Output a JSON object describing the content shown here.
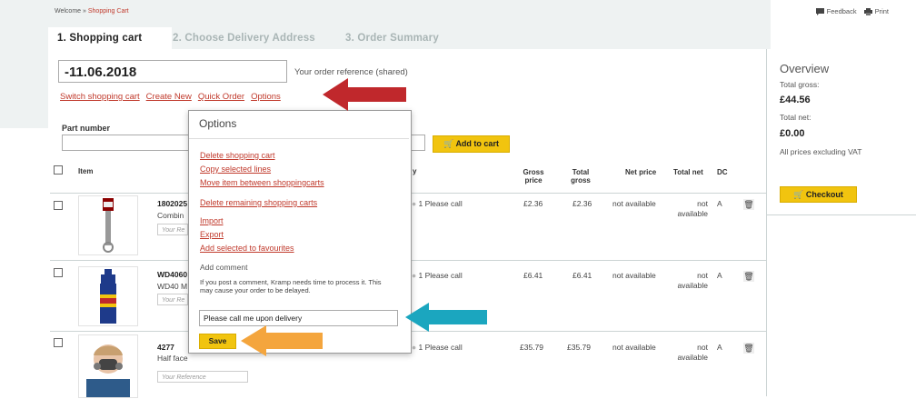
{
  "breadcrumb": {
    "home": "Welcome",
    "separator": "»",
    "current": "Shopping Cart"
  },
  "topright": {
    "feedback": "Feedback",
    "print": "Print"
  },
  "steps": [
    {
      "label": "1.  Shopping cart"
    },
    {
      "label": "2.  Choose Delivery Address"
    },
    {
      "label": "3.  Order Summary"
    }
  ],
  "cart": {
    "reference_value": "-11.06.2018",
    "reference_label": "Your order reference  (shared)",
    "links": [
      "Switch shopping cart",
      "Create New",
      "Quick Order",
      "Options"
    ]
  },
  "part_number": {
    "label": "Part number",
    "add_button": "Add to cart"
  },
  "table": {
    "headers": {
      "item": "Item",
      "qty": "y",
      "gross_price": "Gross price",
      "total_gross": "Total gross",
      "net_price": "Net price",
      "total_net": "Total net",
      "dc": "DC"
    },
    "rows": [
      {
        "part": "1802025",
        "desc": "Combin",
        "ref": "Your Re",
        "availability": "1 Please call",
        "gross": "£2.36",
        "total_gross": "£2.36",
        "net": "not available",
        "total_net": "not available",
        "dc": "A"
      },
      {
        "part": "WD4060",
        "desc": "WD40 M",
        "ref": "Your Re",
        "availability": "1 Please call",
        "gross": "£6.41",
        "total_gross": "£6.41",
        "net": "not available",
        "total_net": "not available",
        "dc": "A"
      },
      {
        "part": "4277",
        "desc": "Half face",
        "ref": "Your Reference",
        "availability": "1 Please call",
        "gross": "£35.79",
        "total_gross": "£35.79",
        "net": "not available",
        "total_net": "not available",
        "dc": "A"
      }
    ]
  },
  "overview": {
    "title": "Overview",
    "total_gross_label": "Total gross:",
    "total_gross_value": "£44.56",
    "total_net_label": "Total net:",
    "total_net_value": "£0.00",
    "note": "All prices excluding VAT",
    "checkout": "Checkout"
  },
  "options_popup": {
    "title": "Options",
    "items": [
      "Delete shopping cart",
      "Copy selected lines",
      "Move item between shoppingcarts",
      "Delete remaining shopping carts",
      "Import",
      "Export",
      "Add selected to favourites"
    ],
    "add_comment": "Add comment",
    "comment_note": "If you post a comment, Kramp needs time to process it. This may cause your order to be delayed.",
    "comment_value": "Please call me upon delivery",
    "save": "Save"
  },
  "colors": {
    "link": "#c0392b",
    "button": "#f1c40f",
    "arrow_red": "#c0282c",
    "arrow_teal": "#1ba6bf",
    "arrow_orange": "#f4a53d"
  }
}
